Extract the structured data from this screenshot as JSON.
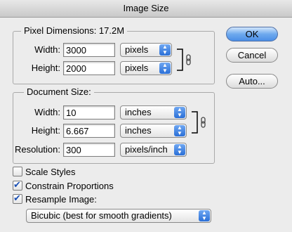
{
  "window": {
    "title": "Image Size"
  },
  "pixel_dimensions": {
    "legend": "Pixel Dimensions:  17.2M",
    "width_label": "Width:",
    "width_value": "3000",
    "width_unit": "pixels",
    "height_label": "Height:",
    "height_value": "2000",
    "height_unit": "pixels"
  },
  "document_size": {
    "legend": "Document Size:",
    "width_label": "Width:",
    "width_value": "10",
    "width_unit": "inches",
    "height_label": "Height:",
    "height_value": "6.667",
    "height_unit": "inches",
    "resolution_label": "Resolution:",
    "resolution_value": "300",
    "resolution_unit": "pixels/inch"
  },
  "buttons": {
    "ok": "OK",
    "cancel": "Cancel",
    "auto": "Auto..."
  },
  "options": {
    "scale_styles": {
      "label": "Scale Styles",
      "checked": false
    },
    "constrain_proportions": {
      "label": "Constrain Proportions",
      "checked": true
    },
    "resample_image": {
      "label": "Resample Image:",
      "checked": true
    }
  },
  "resample_method": "Bicubic (best for smooth gradients)",
  "icons": {
    "arrow": "updown-arrows-icon",
    "link": "chain-link-icon"
  },
  "colors": {
    "accent": "#3f86e4",
    "background": "#ececec"
  }
}
